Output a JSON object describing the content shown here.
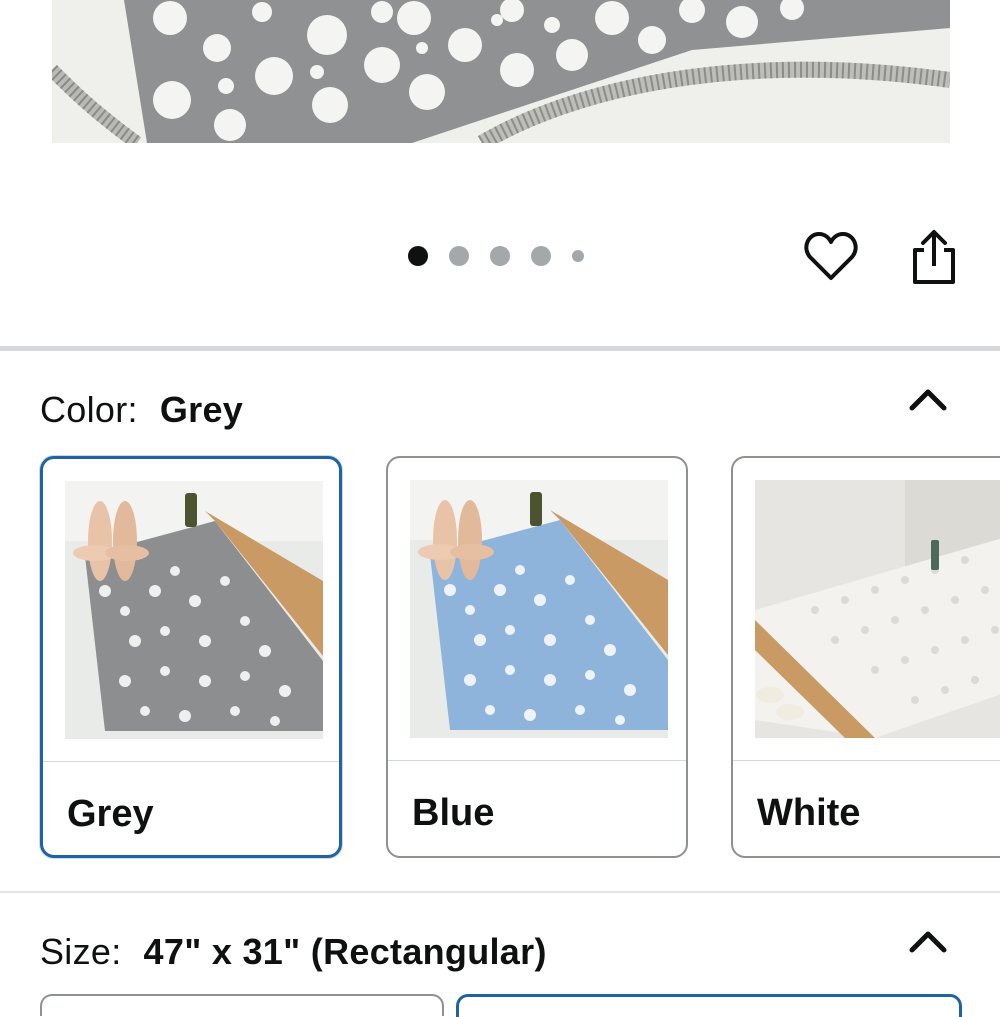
{
  "carousel": {
    "total_dots": 5,
    "active_index": 0
  },
  "actions": {
    "favorite_icon": "heart-icon",
    "share_icon": "share-icon"
  },
  "color_selector": {
    "label": "Color:",
    "selected_value": "Grey",
    "options": [
      {
        "name": "Grey",
        "selected": true,
        "mat_color": "#8c8e90"
      },
      {
        "name": "Blue",
        "selected": false,
        "mat_color": "#8fb4dc"
      },
      {
        "name": "White",
        "selected": false,
        "mat_color": "#f4f2ee"
      }
    ]
  },
  "size_selector": {
    "label": "Size:",
    "selected_value": "47\" x 31\" (Rectangular)"
  },
  "colors": {
    "selected_border": "#2162a1",
    "card_border": "#8d9096",
    "divider": "#d5d9de"
  }
}
